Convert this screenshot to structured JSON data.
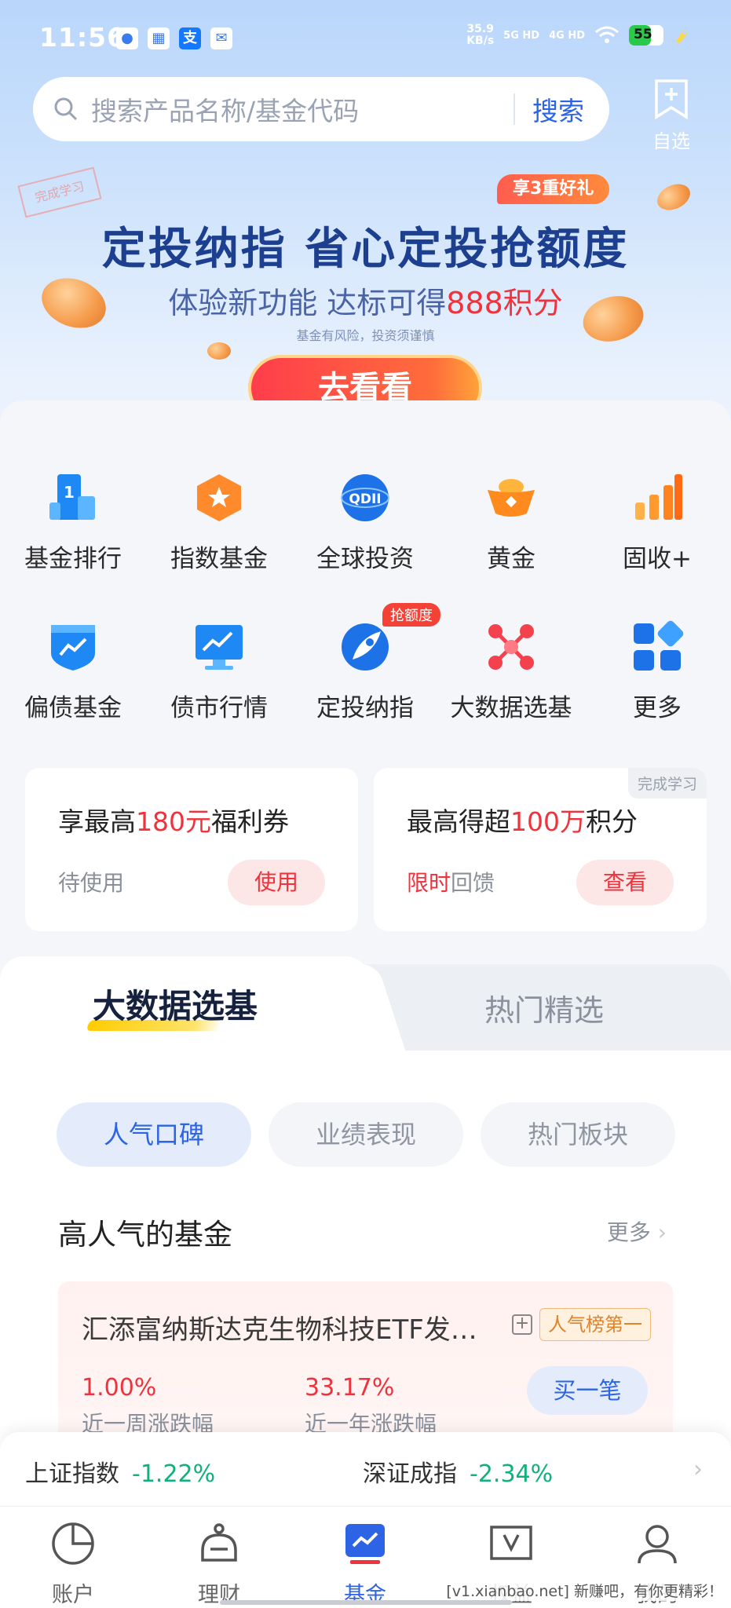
{
  "status_bar": {
    "time": "11:56",
    "net_speed_value": "35.9",
    "net_speed_unit": "KB/s",
    "signal_1": "5G HD",
    "signal_2": "4G HD",
    "battery": "55"
  },
  "search": {
    "placeholder": "搜索产品名称/基金代码",
    "button": "搜索"
  },
  "favorites": {
    "label": "自选"
  },
  "banner": {
    "stamp": "完成学习",
    "badge": "享3重好礼",
    "title": "定投纳指 省心定投抢额度",
    "subtitle_prefix": "体验新功能 达标可得",
    "subtitle_highlight": "888积分",
    "risk_note": "基金有风险，投资须谨慎",
    "cta": "去看看"
  },
  "quick_menu": [
    {
      "label": "基金排行",
      "icon": "ranking-icon"
    },
    {
      "label": "指数基金",
      "icon": "index-fund-icon"
    },
    {
      "label": "全球投资",
      "icon": "qdii-icon",
      "icon_text": "QDII"
    },
    {
      "label": "黄金",
      "icon": "gold-ingot-icon"
    },
    {
      "label": "固收+",
      "icon": "bar-chart-icon"
    },
    {
      "label": "偏债基金",
      "icon": "shield-chart-icon"
    },
    {
      "label": "债市行情",
      "icon": "monitor-chart-icon"
    },
    {
      "label": "定投纳指",
      "icon": "rocket-icon",
      "badge": "抢额度"
    },
    {
      "label": "大数据选基",
      "icon": "network-icon"
    },
    {
      "label": "更多",
      "icon": "more-grid-icon"
    }
  ],
  "promo_cards": [
    {
      "title_prefix": "享最高",
      "title_highlight": "180元",
      "title_suffix": "福利券",
      "sub": "待使用",
      "button": "使用"
    },
    {
      "title_prefix": "最高得超",
      "title_highlight": "100万",
      "title_suffix": "积分",
      "sub_highlight": "限时",
      "sub": "回馈",
      "button": "查看",
      "corner": "完成学习"
    }
  ],
  "section_tabs": {
    "active": "大数据选基",
    "inactive": "热门精选"
  },
  "filter_pills": [
    "人气口碑",
    "业绩表现",
    "热门板块"
  ],
  "list": {
    "title": "高人气的基金",
    "more": "更多",
    "fund": {
      "name": "汇添富纳斯达克生物科技ETF发…",
      "badge": "人气榜第一",
      "week_value": "1.00%",
      "week_label": "近一周涨跌幅",
      "year_value": "33.17%",
      "year_label": "近一年涨跌幅",
      "buy": "买一笔"
    }
  },
  "ticker": {
    "items": [
      {
        "name": "上证指数",
        "value": "-1.22%"
      },
      {
        "name": "深证成指",
        "value": "-2.34%"
      }
    ]
  },
  "tabbar": [
    {
      "label": "账户",
      "icon": "pie-chart-icon"
    },
    {
      "label": "理财",
      "icon": "piggy-bank-icon"
    },
    {
      "label": "基金",
      "icon": "fund-chart-icon",
      "active": true
    },
    {
      "label": "权益",
      "icon": "coupon-icon"
    },
    {
      "label": "我的",
      "icon": "user-icon"
    }
  ],
  "watermark": "[v1.xianbao.net] 新赚吧，有你更精彩！",
  "colors": {
    "accent": "#2d64e5",
    "red": "#f0323c",
    "green": "#0fb27a",
    "gold": "#e0832a"
  }
}
